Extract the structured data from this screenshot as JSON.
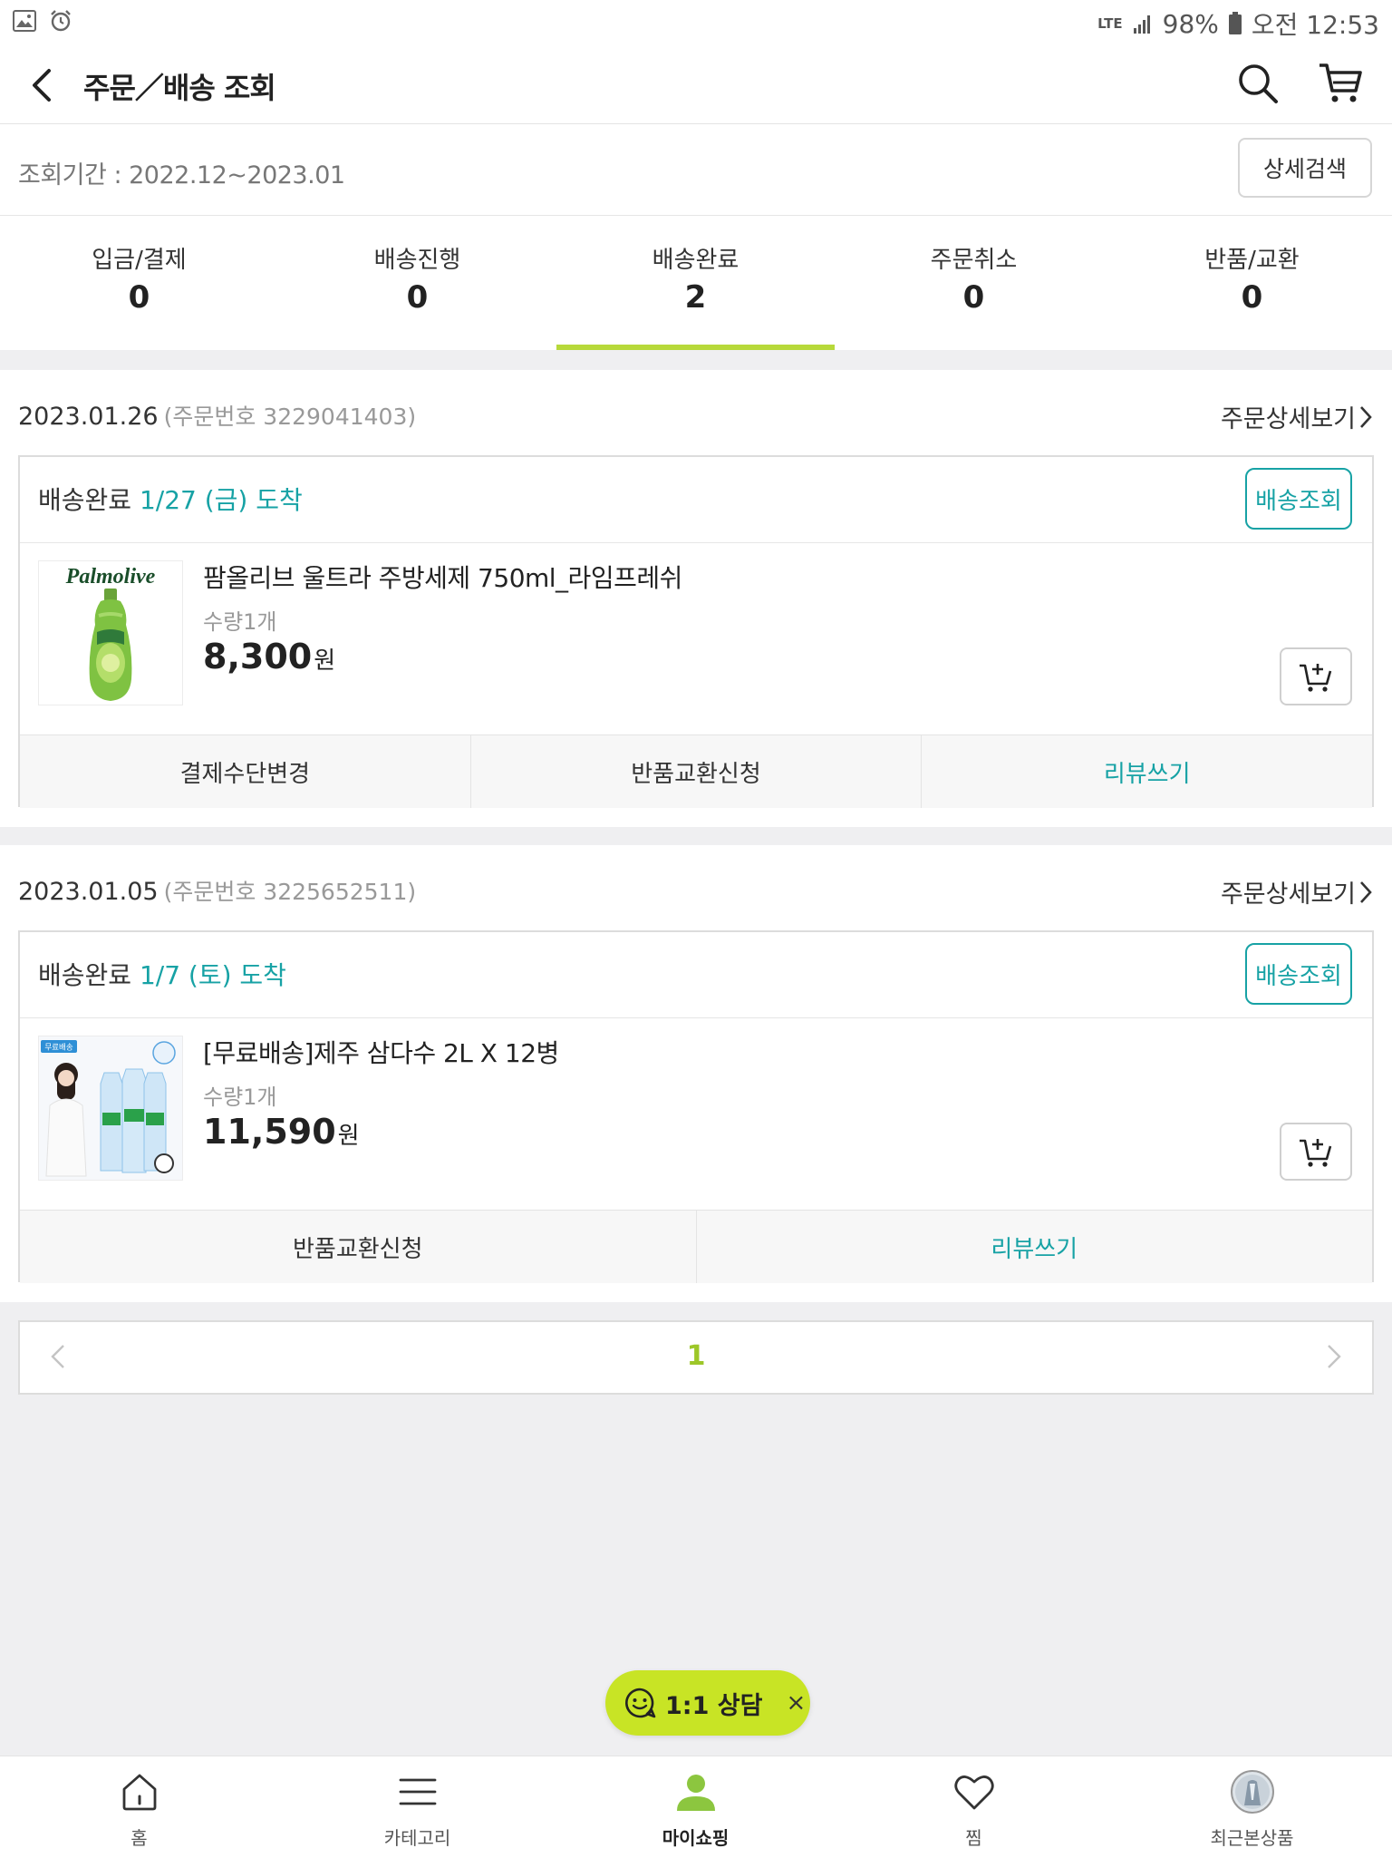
{
  "status_bar": {
    "network": "LTE",
    "battery": "98%",
    "time": "오전 12:53"
  },
  "header": {
    "title": "주문／배송 조회"
  },
  "period": {
    "text": "조회기간 : 2022.12~2023.01",
    "detail_search_label": "상세검색"
  },
  "status_tabs": [
    {
      "label": "입금/결제",
      "count": "0"
    },
    {
      "label": "배송진행",
      "count": "0"
    },
    {
      "label": "배송완료",
      "count": "2",
      "active": true
    },
    {
      "label": "주문취소",
      "count": "0"
    },
    {
      "label": "반품/교환",
      "count": "0"
    }
  ],
  "orders": [
    {
      "date": "2023.01.26",
      "order_number": "(주문번호 3229041403)",
      "detail_label": "주문상세보기",
      "status": "배송완료",
      "arrival": "1/27 (금) 도착",
      "track_label": "배송조회",
      "product": {
        "brand_text": "Palmolive",
        "name": "팜올리브 울트라 주방세제 750ml_라임프레쉬",
        "qty": "수량1개",
        "price": "8,300",
        "currency": "원"
      },
      "actions": [
        "결제수단변경",
        "반품교환신청",
        "리뷰쓰기"
      ]
    },
    {
      "date": "2023.01.05",
      "order_number": "(주문번호 3225652511)",
      "detail_label": "주문상세보기",
      "status": "배송완료",
      "arrival": "1/7 (토) 도착",
      "track_label": "배송조회",
      "product": {
        "badge_text": "무료배송",
        "name": "[무료배송]제주 삼다수 2L X 12병",
        "qty": "수량1개",
        "price": "11,590",
        "currency": "원"
      },
      "actions": [
        "반품교환신청",
        "리뷰쓰기"
      ]
    }
  ],
  "pagination": {
    "current": "1"
  },
  "consult": {
    "label": "1:1 상담",
    "close": "×"
  },
  "bottom_nav": [
    {
      "label": "홈",
      "icon": "home-icon"
    },
    {
      "label": "카테고리",
      "icon": "menu-icon"
    },
    {
      "label": "마이쇼핑",
      "icon": "person-icon",
      "active": true
    },
    {
      "label": "찜",
      "icon": "heart-icon"
    },
    {
      "label": "최근본상품",
      "icon": "recent-product-thumbnail"
    }
  ],
  "colors": {
    "accent_green": "#b7d93a",
    "teal": "#17a2a5",
    "consult_bg": "#c8e425",
    "page_bg": "#efeff1"
  }
}
